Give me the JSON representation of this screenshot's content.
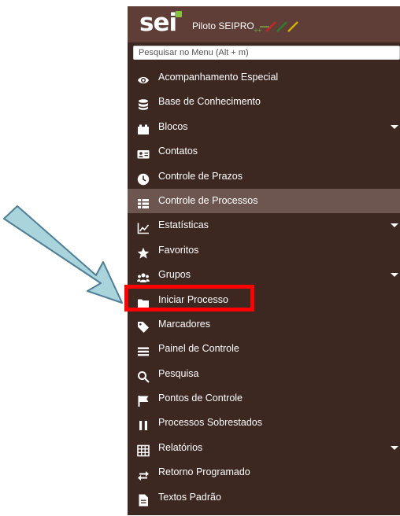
{
  "header": {
    "logo_text": "sei",
    "environment": "Piloto SEIPRO",
    "plus_marks": "++"
  },
  "search": {
    "placeholder": "Pesquisar no Menu (Alt + m)"
  },
  "menu": [
    {
      "label": "Acompanhamento Especial",
      "icon": "eye-icon",
      "has_submenu": false
    },
    {
      "label": "Base de Conhecimento",
      "icon": "database-icon",
      "has_submenu": false
    },
    {
      "label": "Blocos",
      "icon": "blocks-icon",
      "has_submenu": true
    },
    {
      "label": "Contatos",
      "icon": "contact-card-icon",
      "has_submenu": false
    },
    {
      "label": "Controle de Prazos",
      "icon": "clock-icon",
      "has_submenu": false
    },
    {
      "label": "Controle de Processos",
      "icon": "list-icon",
      "has_submenu": false,
      "active": true
    },
    {
      "label": "Estatísticas",
      "icon": "line-chart-icon",
      "has_submenu": true
    },
    {
      "label": "Favoritos",
      "icon": "star-icon",
      "has_submenu": false
    },
    {
      "label": "Grupos",
      "icon": "users-icon",
      "has_submenu": true
    },
    {
      "label": "Iniciar Processo",
      "icon": "folder-icon",
      "has_submenu": false,
      "highlighted": true
    },
    {
      "label": "Marcadores",
      "icon": "tag-icon",
      "has_submenu": false
    },
    {
      "label": "Painel de Controle",
      "icon": "bars-icon",
      "has_submenu": false
    },
    {
      "label": "Pesquisa",
      "icon": "search-icon",
      "has_submenu": false
    },
    {
      "label": "Pontos de Controle",
      "icon": "flag-icon",
      "has_submenu": false
    },
    {
      "label": "Processos Sobrestados",
      "icon": "pause-icon",
      "has_submenu": false
    },
    {
      "label": "Relatórios",
      "icon": "table-icon",
      "has_submenu": true
    },
    {
      "label": "Retorno Programado",
      "icon": "exchange-arrows-icon",
      "has_submenu": false
    },
    {
      "label": "Textos Padrão",
      "icon": "document-icon",
      "has_submenu": false
    }
  ],
  "colors": {
    "menu_background": "#3d2721",
    "header_background": "#5e3e37",
    "active_item": "#6e5650",
    "highlight_border": "#ff0000",
    "arrow_fill": "#a9d4dc",
    "arrow_stroke": "#4f7f97"
  }
}
